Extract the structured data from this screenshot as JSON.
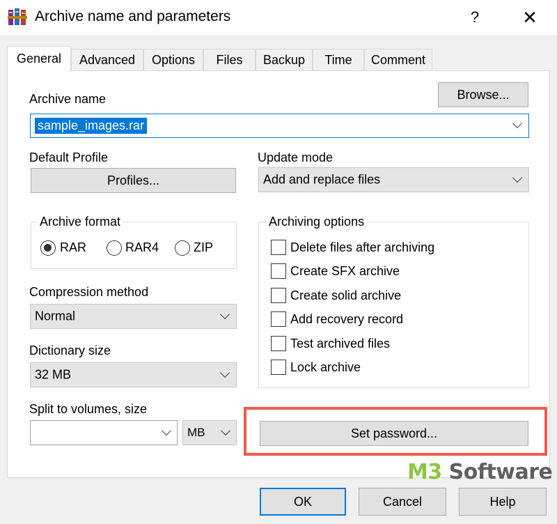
{
  "window": {
    "title": "Archive name and parameters",
    "help_label": "?",
    "close_label": "✕",
    "icon": "winrar-books-icon"
  },
  "tabs": [
    "General",
    "Advanced",
    "Options",
    "Files",
    "Backup",
    "Time",
    "Comment"
  ],
  "archive_name": {
    "label": "Archive name",
    "value": "sample_images.rar",
    "browse_label": "Browse..."
  },
  "profile": {
    "label": "Default Profile",
    "button_label": "Profiles..."
  },
  "update_mode": {
    "label": "Update mode",
    "value": "Add and replace files"
  },
  "archive_format": {
    "label": "Archive format",
    "options": [
      "RAR",
      "RAR4",
      "ZIP"
    ],
    "selected": "RAR"
  },
  "archiving_options": {
    "label": "Archiving options",
    "items": [
      {
        "label": "Delete files after archiving",
        "checked": false
      },
      {
        "label": "Create SFX archive",
        "checked": false
      },
      {
        "label": "Create solid archive",
        "checked": false
      },
      {
        "label": "Add recovery record",
        "checked": false
      },
      {
        "label": "Test archived files",
        "checked": false
      },
      {
        "label": "Lock archive",
        "checked": false
      }
    ]
  },
  "compression": {
    "label": "Compression method",
    "value": "Normal"
  },
  "dictionary": {
    "label": "Dictionary size",
    "value": "32 MB"
  },
  "split": {
    "label": "Split to volumes, size",
    "value": "",
    "unit": "MB"
  },
  "set_password_label": "Set password...",
  "footer": {
    "ok_label": "OK",
    "cancel_label": "Cancel",
    "help_label": "Help"
  },
  "watermark": {
    "prefix": "M3",
    "suffix": " Software"
  },
  "colors": {
    "selection": "#0078d7",
    "highlight_box": "#f05b4a",
    "default_button_border": "#0078d7",
    "watermark_green": "#8cc63f",
    "watermark_grey": "#5f5f5f"
  }
}
